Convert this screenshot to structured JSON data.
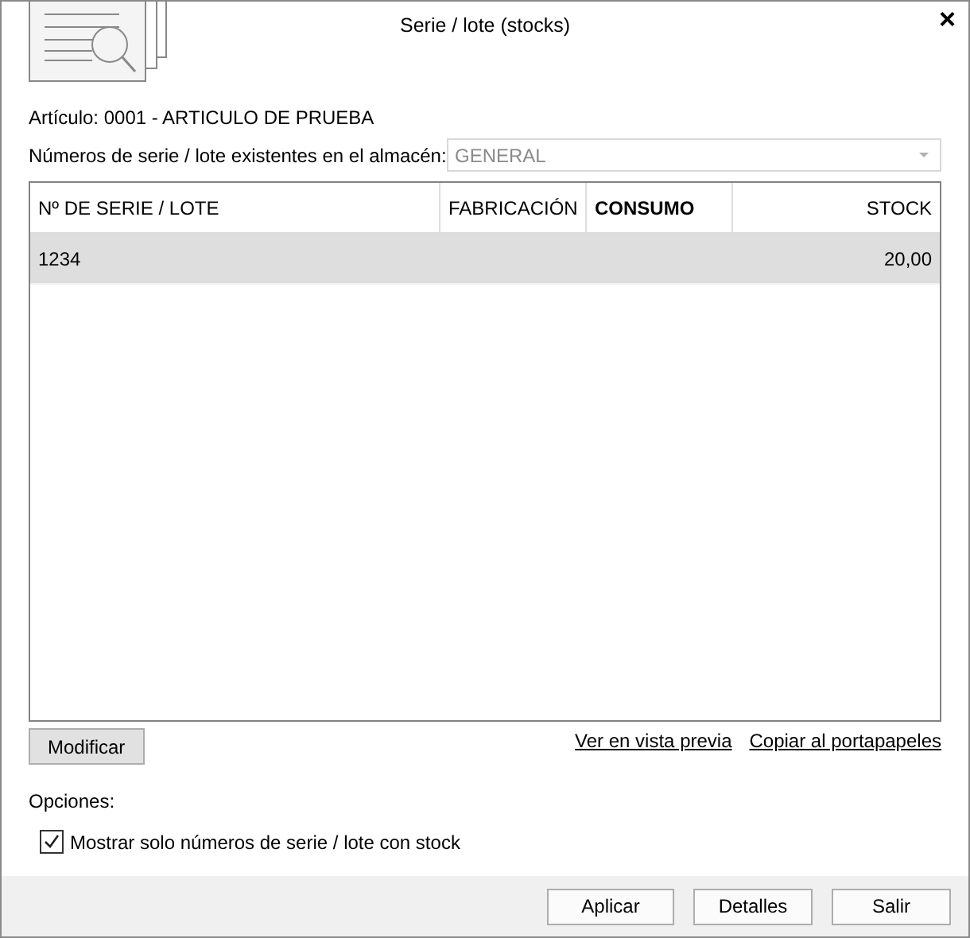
{
  "window": {
    "title": "Serie / lote (stocks)",
    "close": "×"
  },
  "article": "Artículo: 0001 - ARTICULO DE PRUEBA",
  "warehouse": {
    "label": "Números de serie / lote existentes en el almacén:",
    "value": "GENERAL",
    "disabled": true
  },
  "table": {
    "columns": [
      {
        "label": "Nº DE SERIE / LOTE",
        "emphasized": false,
        "kind": "text"
      },
      {
        "label": "FABRICACIÓN",
        "emphasized": false,
        "kind": "text"
      },
      {
        "label": "CONSUMO",
        "emphasized": true,
        "kind": "text"
      },
      {
        "label": "STOCK",
        "emphasized": false,
        "kind": "number"
      }
    ],
    "rows": [
      {
        "cells": [
          "1234",
          "",
          "",
          "20,00"
        ],
        "selected": true
      }
    ]
  },
  "modify_button": "Modificar",
  "links": [
    "Ver en vista previa",
    "Copiar al portapapeles"
  ],
  "options": {
    "label": "Opciones:",
    "checkbox": {
      "label": "Mostrar solo números de serie / lote con stock",
      "checked": true
    }
  },
  "buttons": [
    "Aplicar",
    "Detalles",
    "Salir"
  ]
}
